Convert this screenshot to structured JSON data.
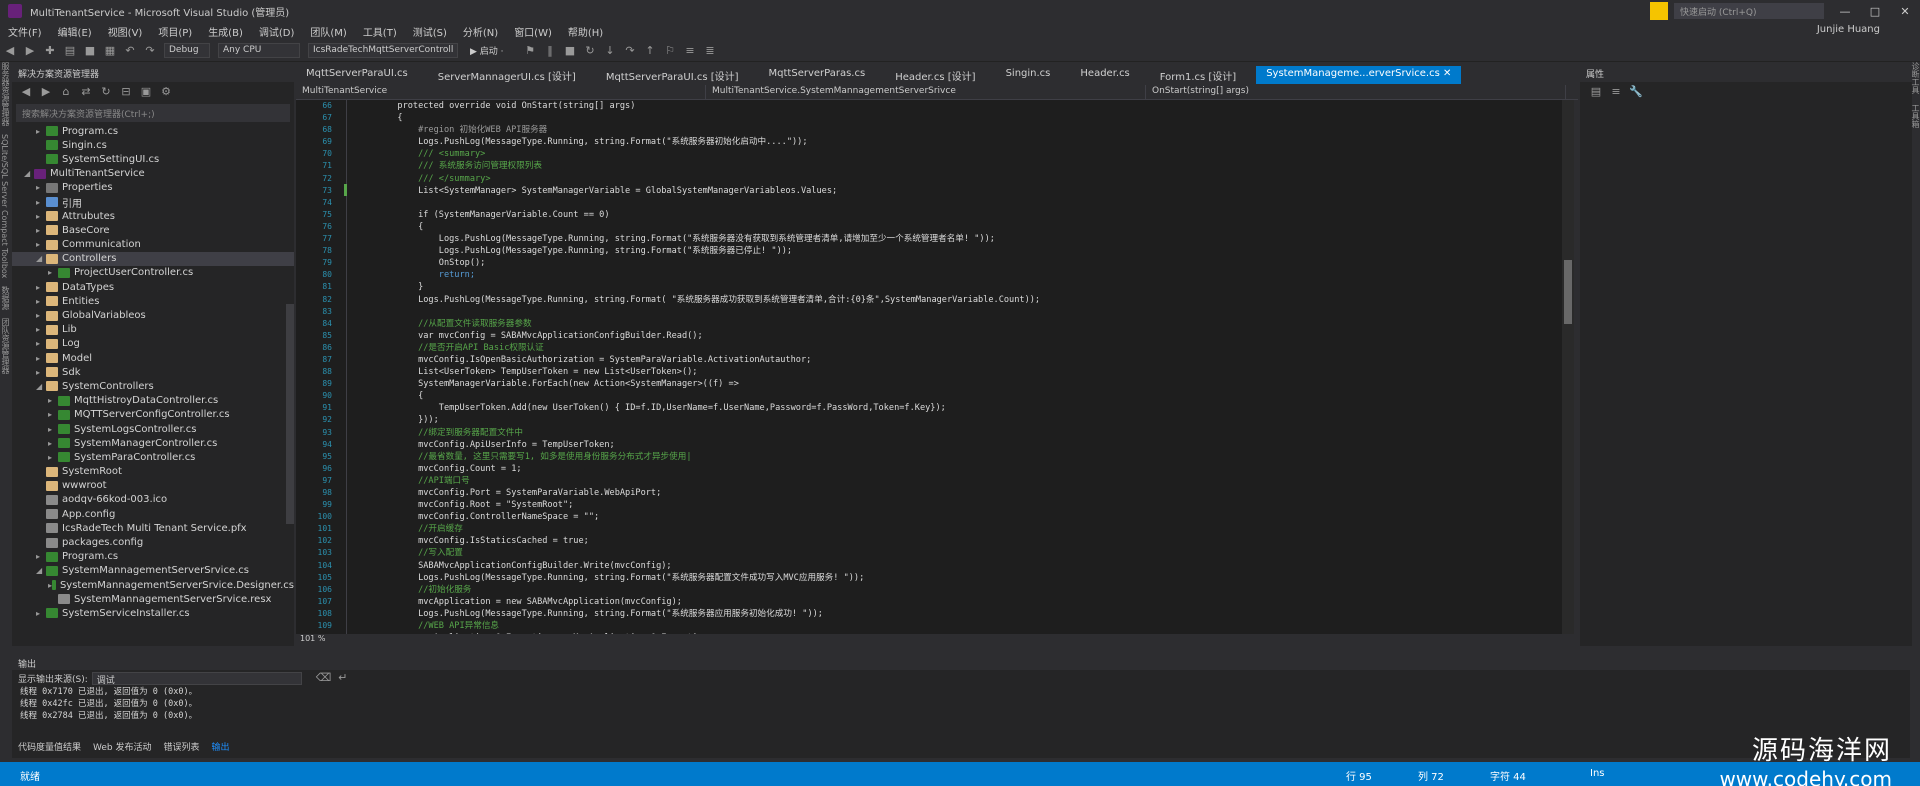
{
  "window": {
    "title": "MultiTenantService - Microsoft Visual Studio (管理员)",
    "quick_launch_placeholder": "快速启动 (Ctrl+Q)",
    "user": "Junjie Huang",
    "controls": [
      "—",
      "□",
      "✕"
    ]
  },
  "menu": [
    "文件(F)",
    "编辑(E)",
    "视图(V)",
    "项目(P)",
    "生成(B)",
    "调试(D)",
    "团队(M)",
    "工具(T)",
    "测试(S)",
    "分析(N)",
    "窗口(W)",
    "帮助(H)"
  ],
  "toolbar": {
    "configuration": "Debug",
    "platform": "Any CPU",
    "startup_project": "IcsRadeTechMqttServerControll",
    "start_label": "▶ 启动 ·"
  },
  "left_strip": [
    "服务器资源管理器",
    "SQLite/SQL Server Compact Toolbox",
    "数据源",
    "团队资源管理器"
  ],
  "right_strip": [
    "诊断工具",
    "工具箱"
  ],
  "solution_explorer": {
    "title": "解决方案资源管理器",
    "search_placeholder": "搜索解决方案资源管理器(Ctrl+;)",
    "items": [
      {
        "label": "Program.cs",
        "indent": 2,
        "icon": "cs",
        "arrow": "▸"
      },
      {
        "label": "Singin.cs",
        "indent": 2,
        "icon": "cs",
        "arrow": ""
      },
      {
        "label": "SystemSettingUI.cs",
        "indent": 2,
        "icon": "cs",
        "arrow": ""
      },
      {
        "label": "MultiTenantService",
        "indent": 1,
        "icon": "proj",
        "arrow": "◢"
      },
      {
        "label": "Properties",
        "indent": 2,
        "icon": "prop",
        "arrow": "▸"
      },
      {
        "label": "引用",
        "indent": 2,
        "icon": "ref",
        "arrow": "▸"
      },
      {
        "label": "Attrubutes",
        "indent": 2,
        "icon": "folder",
        "arrow": "▸"
      },
      {
        "label": "BaseCore",
        "indent": 2,
        "icon": "folder",
        "arrow": "▸"
      },
      {
        "label": "Communication",
        "indent": 2,
        "icon": "folder",
        "arrow": "▸"
      },
      {
        "label": "Controllers",
        "indent": 2,
        "icon": "folder",
        "arrow": "◢",
        "selected": true
      },
      {
        "label": "ProjectUserController.cs",
        "indent": 3,
        "icon": "cs",
        "arrow": "▸"
      },
      {
        "label": "DataTypes",
        "indent": 2,
        "icon": "folder",
        "arrow": "▸"
      },
      {
        "label": "Entities",
        "indent": 2,
        "icon": "folder",
        "arrow": "▸"
      },
      {
        "label": "GlobalVariableos",
        "indent": 2,
        "icon": "folder",
        "arrow": "▸"
      },
      {
        "label": "Lib",
        "indent": 2,
        "icon": "folder",
        "arrow": "▸"
      },
      {
        "label": "Log",
        "indent": 2,
        "icon": "folder",
        "arrow": "▸"
      },
      {
        "label": "Model",
        "indent": 2,
        "icon": "folder",
        "arrow": "▸"
      },
      {
        "label": "Sdk",
        "indent": 2,
        "icon": "folder",
        "arrow": "▸"
      },
      {
        "label": "SystemControllers",
        "indent": 2,
        "icon": "folder",
        "arrow": "◢"
      },
      {
        "label": "MqttHistroyDataController.cs",
        "indent": 3,
        "icon": "cs",
        "arrow": "▸"
      },
      {
        "label": "MQTTServerConfigController.cs",
        "indent": 3,
        "icon": "cs",
        "arrow": "▸"
      },
      {
        "label": "SystemLogsController.cs",
        "indent": 3,
        "icon": "cs",
        "arrow": "▸"
      },
      {
        "label": "SystemManagerController.cs",
        "indent": 3,
        "icon": "cs",
        "arrow": "▸"
      },
      {
        "label": "SystemParaController.cs",
        "indent": 3,
        "icon": "cs",
        "arrow": "▸"
      },
      {
        "label": "SystemRoot",
        "indent": 2,
        "icon": "folder",
        "arrow": ""
      },
      {
        "label": "wwwroot",
        "indent": 2,
        "icon": "folder",
        "arrow": ""
      },
      {
        "label": "aodqv-66kod-003.ico",
        "indent": 2,
        "icon": "cfg",
        "arrow": ""
      },
      {
        "label": "App.config",
        "indent": 2,
        "icon": "cfg",
        "arrow": ""
      },
      {
        "label": "IcsRadeTech Multi Tenant Service.pfx",
        "indent": 2,
        "icon": "cfg",
        "arrow": ""
      },
      {
        "label": "packages.config",
        "indent": 2,
        "icon": "cfg",
        "arrow": ""
      },
      {
        "label": "Program.cs",
        "indent": 2,
        "icon": "cs",
        "arrow": "▸"
      },
      {
        "label": "SystemMannagementServerSrvice.cs",
        "indent": 2,
        "icon": "cs",
        "arrow": "◢"
      },
      {
        "label": "SystemMannagementServerSrvice.Designer.cs",
        "indent": 3,
        "icon": "cs",
        "arrow": "▸"
      },
      {
        "label": "SystemMannagementServerSrvice.resx",
        "indent": 3,
        "icon": "cfg",
        "arrow": ""
      },
      {
        "label": "SystemServiceInstaller.cs",
        "indent": 2,
        "icon": "cs",
        "arrow": "▸"
      }
    ]
  },
  "tabs": [
    {
      "label": "MqttServerParaUI.cs",
      "active": false
    },
    {
      "label": "ServerMannagerUI.cs [设计]",
      "active": false
    },
    {
      "label": "MqttServerParaUI.cs [设计]",
      "active": false
    },
    {
      "label": "MqttServerParas.cs",
      "active": false
    },
    {
      "label": "Header.cs [设计]",
      "active": false
    },
    {
      "label": "Singin.cs",
      "active": false
    },
    {
      "label": "Header.cs",
      "active": false
    },
    {
      "label": "Form1.cs [设计]",
      "active": false
    },
    {
      "label": "SystemManageme...erverSrvice.cs  ✕",
      "active": true
    }
  ],
  "navbar": {
    "project": "MultiTenantService",
    "type": "MultiTenantService.SystemMannagementServerSrivce",
    "member": "OnStart(string[] args)"
  },
  "code": {
    "zoom": "101 %",
    "lines": [
      {
        "n": "66",
        "text": "        protected override void OnStart(string[] args)",
        "color": "#dcdcdc"
      },
      {
        "n": "67",
        "text": "        {",
        "color": "#dcdcdc"
      },
      {
        "n": "68",
        "text": "            #region 初始化WEB API服务器",
        "color": "#9b9b9b"
      },
      {
        "n": "69",
        "text": "            Logs.PushLog(MessageType.Running, string.Format(\"系统服务器初始化启动中....\"));",
        "color": "#dcdcdc"
      },
      {
        "n": "70",
        "text": "            /// <summary>",
        "color": "#57a64a"
      },
      {
        "n": "71",
        "text": "            /// 系统服务访问管理权限列表",
        "color": "#57a64a"
      },
      {
        "n": "72",
        "text": "            /// </summary>",
        "color": "#57a64a"
      },
      {
        "n": "73",
        "text": "            List<SystemManager> SystemManagerVariable = GlobalSystemManagerVariableos.Values;",
        "color": "#dcdcdc"
      },
      {
        "n": "74",
        "text": "",
        "color": "#dcdcdc"
      },
      {
        "n": "75",
        "text": "            if (SystemManagerVariable.Count == 0)",
        "color": "#dcdcdc"
      },
      {
        "n": "76",
        "text": "            {",
        "color": "#dcdcdc"
      },
      {
        "n": "77",
        "text": "                Logs.PushLog(MessageType.Running, string.Format(\"系统服务器没有获取到系统管理者清单,请增加至少一个系统管理者名单! \"));",
        "color": "#dcdcdc"
      },
      {
        "n": "78",
        "text": "                Logs.PushLog(MessageType.Running, string.Format(\"系统服务器已停止! \"));",
        "color": "#dcdcdc"
      },
      {
        "n": "79",
        "text": "                OnStop();",
        "color": "#dcdcdc"
      },
      {
        "n": "80",
        "text": "                return;",
        "color": "#569cd6"
      },
      {
        "n": "81",
        "text": "            }",
        "color": "#dcdcdc"
      },
      {
        "n": "82",
        "text": "            Logs.PushLog(MessageType.Running, string.Format( \"系统服务器成功获取到系统管理者清单,合计:{0}条\",SystemManagerVariable.Count));",
        "color": "#dcdcdc"
      },
      {
        "n": "83",
        "text": "",
        "color": "#dcdcdc"
      },
      {
        "n": "84",
        "text": "            //从配置文件读取服务器参数",
        "color": "#57a64a"
      },
      {
        "n": "85",
        "text": "            var mvcConfig = SABAMvcApplicationConfigBuilder.Read();",
        "color": "#dcdcdc"
      },
      {
        "n": "86",
        "text": "            //是否开启API Basic权限认证",
        "color": "#57a64a"
      },
      {
        "n": "87",
        "text": "            mvcConfig.IsOpenBasicAuthorization = SystemParaVariable.ActivationAutauthor;",
        "color": "#dcdcdc"
      },
      {
        "n": "88",
        "text": "            List<UserToken> TempUserToken = new List<UserToken>();",
        "color": "#dcdcdc"
      },
      {
        "n": "89",
        "text": "            SystemManagerVariable.ForEach(new Action<SystemManager>((f) =>",
        "color": "#dcdcdc"
      },
      {
        "n": "90",
        "text": "            {",
        "color": "#dcdcdc"
      },
      {
        "n": "91",
        "text": "                TempUserToken.Add(new UserToken() { ID=f.ID,UserName=f.UserName,Password=f.PassWord,Token=f.Key});",
        "color": "#dcdcdc"
      },
      {
        "n": "92",
        "text": "            }));",
        "color": "#dcdcdc"
      },
      {
        "n": "93",
        "text": "            //绑定到服务器配置文件中",
        "color": "#57a64a"
      },
      {
        "n": "94",
        "text": "            mvcConfig.ApiUserInfo = TempUserToken;",
        "color": "#dcdcdc"
      },
      {
        "n": "95",
        "text": "            //最省数量, 这里只需要写1, 如多是使用身份服务分布式才异步使用|",
        "color": "#57a64a"
      },
      {
        "n": "96",
        "text": "            mvcConfig.Count = 1;",
        "color": "#dcdcdc"
      },
      {
        "n": "97",
        "text": "            //API端口号",
        "color": "#57a64a"
      },
      {
        "n": "98",
        "text": "            mvcConfig.Port = SystemParaVariable.WebApiPort;",
        "color": "#dcdcdc"
      },
      {
        "n": "99",
        "text": "            mvcConfig.Root = \"SystemRoot\";",
        "color": "#dcdcdc"
      },
      {
        "n": "100",
        "text": "            mvcConfig.ControllerNameSpace = \"\";",
        "color": "#dcdcdc"
      },
      {
        "n": "101",
        "text": "            //开启缓存",
        "color": "#57a64a"
      },
      {
        "n": "102",
        "text": "            mvcConfig.IsStaticsCached = true;",
        "color": "#dcdcdc"
      },
      {
        "n": "103",
        "text": "            //写入配置",
        "color": "#57a64a"
      },
      {
        "n": "104",
        "text": "            SABAMvcApplicationConfigBuilder.Write(mvcConfig);",
        "color": "#dcdcdc"
      },
      {
        "n": "105",
        "text": "            Logs.PushLog(MessageType.Running, string.Format(\"系统服务器配置文件成功写入MVC应用服务! \"));",
        "color": "#dcdcdc"
      },
      {
        "n": "106",
        "text": "            //初始化服务",
        "color": "#57a64a"
      },
      {
        "n": "107",
        "text": "            mvcApplication = new SABAMvcApplication(mvcConfig);",
        "color": "#dcdcdc"
      },
      {
        "n": "108",
        "text": "            Logs.PushLog(MessageType.Running, string.Format(\"系统服务器应用服务初始化成功! \"));",
        "color": "#dcdcdc"
      },
      {
        "n": "109",
        "text": "            //WEB API异常信息",
        "color": "#57a64a"
      },
      {
        "n": "110",
        "text": "            mvcApplication.OnException += MvcApplication_OnException;",
        "color": "#dcdcdc"
      }
    ]
  },
  "properties": {
    "title": "属性"
  },
  "output": {
    "title": "输出",
    "source_label": "显示输出来源(S):",
    "source_value": "调试",
    "lines": [
      "线程 0x7170 已退出, 返回值为 0 (0x0)。",
      "线程 0x42fc 已退出, 返回值为 0 (0x0)。",
      "线程 0x2784 已退出, 返回值为 0 (0x0)。"
    ]
  },
  "bottom_tabs": [
    {
      "label": "代码度量值结果",
      "active": false
    },
    {
      "label": "Web 发布活动",
      "active": false
    },
    {
      "label": "错误列表",
      "active": false
    },
    {
      "label": "输出",
      "active": true
    }
  ],
  "status": {
    "ready": "就绪",
    "line": "行 95",
    "col": "列 72",
    "char": "字符 44",
    "mode": "Ins"
  },
  "watermark": {
    "line1": "源码海洋网",
    "line2": "www.codehy.com"
  }
}
